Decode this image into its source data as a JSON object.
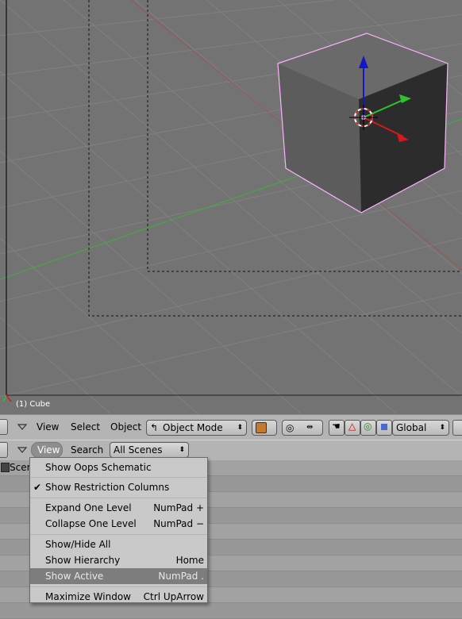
{
  "viewport": {
    "object_label": "(1) Cube"
  },
  "header3d": {
    "menus": [
      "View",
      "Select",
      "Object"
    ],
    "mode": "Object Mode",
    "orientation": "Global"
  },
  "outliner_header": {
    "view_menu": "View",
    "search_menu": "Search",
    "scene_filter": "All Scenes"
  },
  "outliner": {
    "row_label": "Scer"
  },
  "view_menu": {
    "items": [
      {
        "label": "Show Oops Schematic",
        "shortcut": ""
      },
      {
        "label": "Show Restriction Columns",
        "shortcut": "",
        "checked": true
      },
      {
        "label": "Expand One Level",
        "shortcut": "NumPad +"
      },
      {
        "label": "Collapse One Level",
        "shortcut": "NumPad −"
      },
      {
        "label": "Show/Hide All",
        "shortcut": ""
      },
      {
        "label": "Show Hierarchy",
        "shortcut": "Home"
      },
      {
        "label": "Show Active",
        "shortcut": "NumPad .",
        "highlighted": true
      },
      {
        "label": "Maximize Window",
        "shortcut": "Ctrl UpArrow"
      }
    ]
  },
  "colors": {
    "accent_blue": "#1515c8",
    "accent_green": "#2cc42c",
    "accent_red": "#d81818",
    "selection_outline": "#ffb0ff"
  }
}
